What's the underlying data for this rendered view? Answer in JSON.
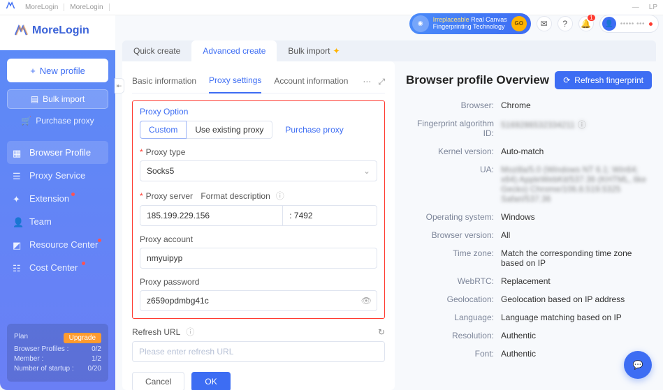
{
  "titlebar": {
    "app1": "MoreLogin",
    "app2": "MoreLogin",
    "min": "—",
    "restore": "LP"
  },
  "logo": {
    "text": "MoreLogin"
  },
  "sidebar": {
    "new_profile": "New profile",
    "bulk_import": "Bulk import",
    "purchase_proxy": "Purchase proxy",
    "nav": [
      {
        "label": "Browser Profile"
      },
      {
        "label": "Proxy Service"
      },
      {
        "label": "Extension"
      },
      {
        "label": "Team"
      },
      {
        "label": "Resource Center"
      },
      {
        "label": "Cost Center"
      }
    ]
  },
  "plan": {
    "plan_label": "Plan",
    "upgrade": "Upgrade",
    "rows": [
      {
        "k": "Browser Profiles :",
        "v": "0/2"
      },
      {
        "k": "Member :",
        "v": "1/2"
      },
      {
        "k": "Number of startup :",
        "v": "0/20"
      }
    ]
  },
  "banner": {
    "l1": "Irreplaceable",
    "l1b": "Real Canvas",
    "l2": "Fingerprinting Technology",
    "go": "GO"
  },
  "user": {
    "name": "••••• •••"
  },
  "main_tabs": {
    "quick": "Quick create",
    "advanced": "Advanced create",
    "bulk": "Bulk import"
  },
  "sub_tabs": {
    "basic": "Basic information",
    "proxy": "Proxy settings",
    "account": "Account information"
  },
  "form": {
    "proxy_option_label": "Proxy Option",
    "custom": "Custom",
    "use_existing": "Use existing proxy",
    "purchase_proxy": "Purchase proxy",
    "proxy_type_label": "Proxy type",
    "proxy_type_value": "Socks5",
    "proxy_server_label": "Proxy server",
    "format_desc": "Format description",
    "server_host": "185.199.229.156",
    "server_port": ": 7492",
    "proxy_account_label": "Proxy account",
    "proxy_account_value": "nmyuipyp",
    "proxy_password_label": "Proxy password",
    "proxy_password_value": "z659opdmbg41c",
    "refresh_url_label": "Refresh URL",
    "refresh_url_placeholder": "Please enter refresh URL",
    "cancel": "Cancel",
    "ok": "OK"
  },
  "overview": {
    "title": "Browser profile Overview",
    "refresh": "Refresh fingerprint",
    "rows": [
      {
        "k": "Browser:",
        "v": "Chrome"
      },
      {
        "k": "Fingerprint algorithm ID:",
        "v": "5169286532334211",
        "blur": true,
        "help": true
      },
      {
        "k": "Kernel version:",
        "v": "Auto-match"
      },
      {
        "k": "UA:",
        "v": "Mozilla/5.0 (Windows NT 6.1; Win64; x64) AppleWebKit/537.36 (KHTML, like Gecko) Chrome/106.8.519.5325 Safari/537.36",
        "blur": true
      },
      {
        "k": "Operating system:",
        "v": "Windows"
      },
      {
        "k": "Browser version:",
        "v": "All"
      },
      {
        "k": "Time zone:",
        "v": "Match the corresponding time zone based on IP"
      },
      {
        "k": "WebRTC:",
        "v": "Replacement"
      },
      {
        "k": "Geolocation:",
        "v": "Geolocation based on IP address"
      },
      {
        "k": "Language:",
        "v": "Language matching based on IP"
      },
      {
        "k": "Resolution:",
        "v": "Authentic"
      },
      {
        "k": "Font:",
        "v": "Authentic"
      }
    ]
  },
  "notif_count": "1"
}
